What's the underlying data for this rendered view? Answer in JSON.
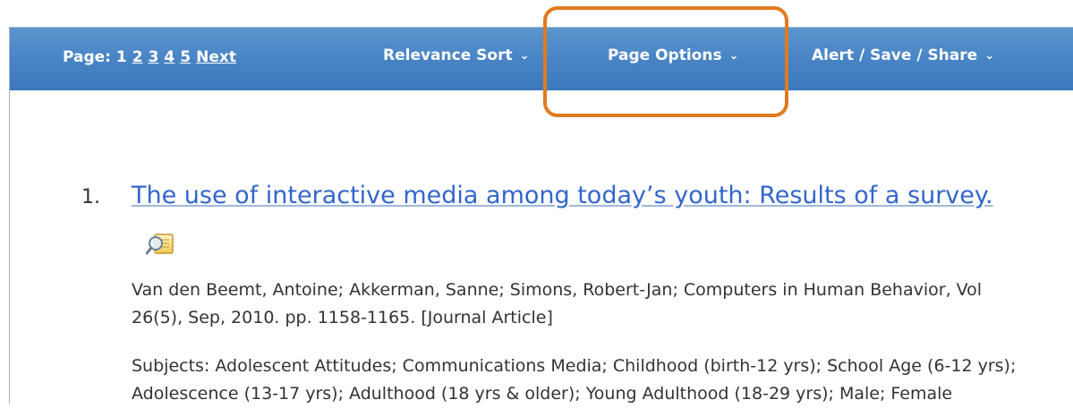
{
  "toolbar": {
    "page_label": "Page: 1",
    "pages": [
      "2",
      "3",
      "4",
      "5"
    ],
    "next_label": "Next",
    "sort_label": "Relevance Sort",
    "page_options_label": "Page Options",
    "alert_label": "Alert / Save / Share",
    "chevron": "⌄"
  },
  "result": {
    "number": "1.",
    "title": "The use of interactive media among today’s youth: Results of a survey.",
    "preview_icon": "magnifier-document-icon",
    "citation": "Van den Beemt, Antoine; Akkerman, Sanne; Simons, Robert-Jan; Computers in Human Behavior, Vol 26(5), Sep, 2010. pp. 1158-1165. [Journal Article]",
    "subjects": "Subjects: Adolescent Attitudes; Communications Media; Childhood (birth-12 yrs); School Age (6-12 yrs); Adolescence (13-17 yrs); Adulthood (18 yrs & older); Young Adulthood (18-29 yrs); Male; Female"
  },
  "colors": {
    "toolbar_top": "#5d95cf",
    "toolbar_bottom": "#3b78bb",
    "link": "#3366cc",
    "highlight": "#e07b1f"
  }
}
